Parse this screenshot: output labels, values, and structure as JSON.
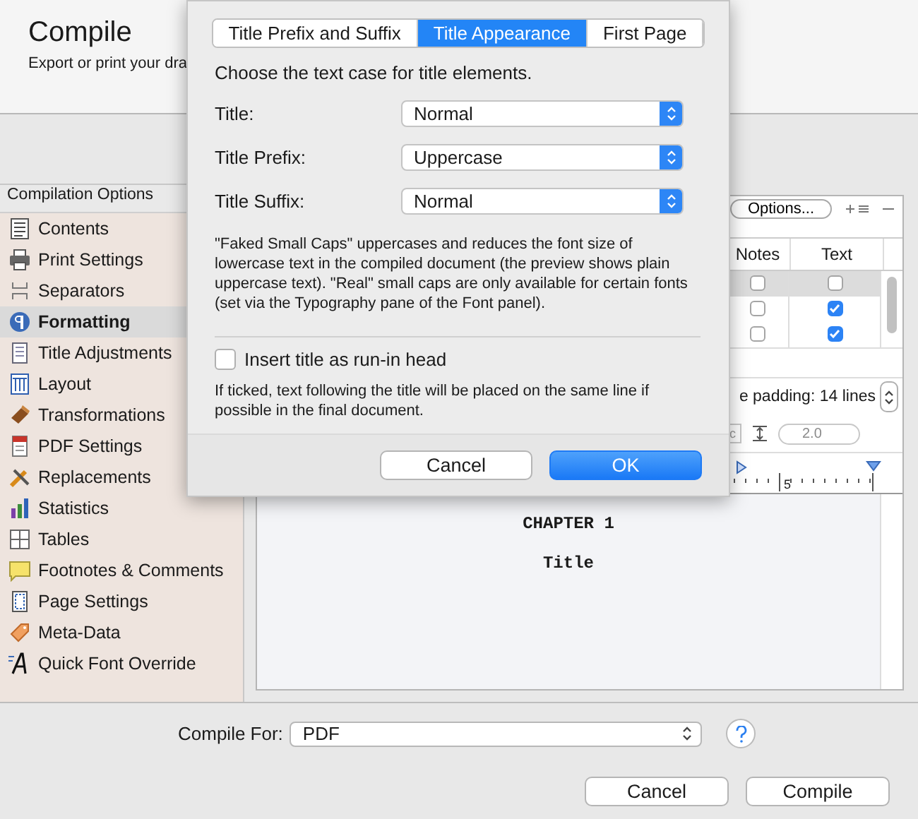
{
  "header": {
    "title": "Compile",
    "subtitle": "Export or print your dra"
  },
  "sidebar": {
    "title": "Compilation Options",
    "items": [
      {
        "label": "Contents",
        "selected": false
      },
      {
        "label": "Print Settings",
        "selected": false
      },
      {
        "label": "Separators",
        "selected": false
      },
      {
        "label": "Formatting",
        "selected": true
      },
      {
        "label": "Title Adjustments",
        "selected": false
      },
      {
        "label": "Layout",
        "selected": false
      },
      {
        "label": "Transformations",
        "selected": false
      },
      {
        "label": "PDF Settings",
        "selected": false
      },
      {
        "label": "Replacements",
        "selected": false
      },
      {
        "label": "Statistics",
        "selected": false
      },
      {
        "label": "Tables",
        "selected": false
      },
      {
        "label": "Footnotes & Comments",
        "selected": false
      },
      {
        "label": "Page Settings",
        "selected": false
      },
      {
        "label": "Meta-Data",
        "selected": false
      },
      {
        "label": "Quick Font Override",
        "selected": false
      }
    ]
  },
  "contents_table": {
    "options_button": "Options...",
    "columns": [
      "Notes",
      "Text"
    ],
    "rows": [
      {
        "selected": true,
        "notes": false,
        "text": false
      },
      {
        "selected": false,
        "notes": false,
        "text": true
      },
      {
        "selected": false,
        "notes": false,
        "text": true
      }
    ]
  },
  "format_bar": {
    "padding_label": "e padding: 14 lines",
    "style_popup": "c",
    "line_spacing": "2.0"
  },
  "ruler": {
    "mark": "5"
  },
  "preview": {
    "lines": [
      "CHAPTER 1",
      "Title"
    ]
  },
  "compile_for": {
    "label": "Compile For:",
    "value": "PDF"
  },
  "buttons": [
    "Cancel",
    "Compile"
  ],
  "sheet": {
    "tabs": [
      {
        "label": "Title Prefix and Suffix",
        "selected": false
      },
      {
        "label": "Title Appearance",
        "selected": true
      },
      {
        "label": "First Page",
        "selected": false
      }
    ],
    "intro": "Choose the text case for title elements.",
    "fields": [
      {
        "label": "Title:",
        "value": "Normal"
      },
      {
        "label": "Title Prefix:",
        "value": "Uppercase"
      },
      {
        "label": "Title Suffix:",
        "value": "Normal"
      }
    ],
    "note": "\"Faked Small Caps\" uppercases and reduces the font size of lowercase text in the compiled document (the preview shows plain uppercase text). \"Real\" small caps are only available for certain fonts (set via the Typography pane of the Font panel).",
    "run_in": {
      "label": "Insert title as run-in head",
      "checked": false
    },
    "run_in_hint": "If ticked, text following the title will be placed on the same line if possible in the final document.",
    "buttons": [
      {
        "label": "Cancel",
        "default": false
      },
      {
        "label": "OK",
        "default": true
      }
    ]
  }
}
